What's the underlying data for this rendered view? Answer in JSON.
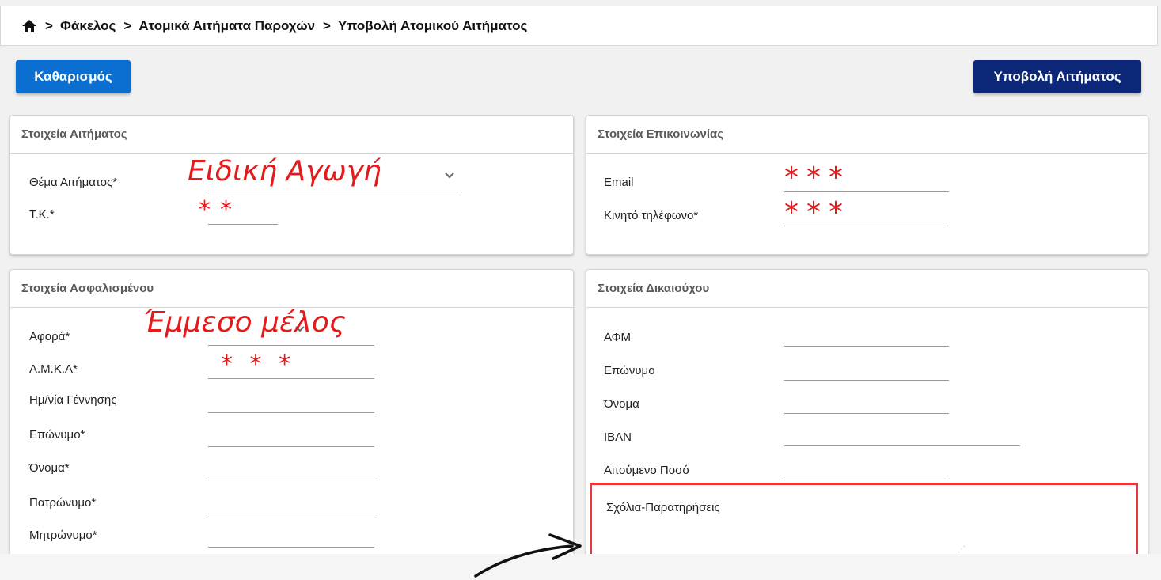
{
  "breadcrumb": {
    "home_icon": "home-icon",
    "items": [
      "Φάκελος",
      "Ατομικά Αιτήματα Παροχών",
      "Υποβολή Ατομικού Αιτήματος"
    ],
    "separator": ">"
  },
  "toolbar": {
    "clear_label": "Καθαρισμός",
    "submit_label": "Υποβολή Αιτήματος"
  },
  "request_panel": {
    "title": "Στοιχεία Αιτήματος",
    "subject_label": "Θέμα Αιτήματος*",
    "subject_value": "Ειδική Αγωγή",
    "zip_label": "Τ.Κ.*",
    "zip_value": "**"
  },
  "contact_panel": {
    "title": "Στοιχεία Επικοινωνίας",
    "email_label": "Email",
    "email_value": "***",
    "mobile_label": "Κινητό τηλέφωνο*",
    "mobile_value": "***"
  },
  "insured_panel": {
    "title": "Στοιχεία Ασφαλισμένου",
    "concerns_label": "Αφορά*",
    "concerns_value": "Έμμεσο μέλος",
    "amka_label": "Α.Μ.Κ.Α*",
    "amka_value": "* * *",
    "birthdate_label": "Ημ/νία Γέννησης",
    "surname_label": "Επώνυμο*",
    "name_label": "Όνομα*",
    "father_label": "Πατρώνυμο*",
    "mother_label": "Μητρώνυμο*"
  },
  "beneficiary_panel": {
    "title": "Στοιχεία Δικαιούχου",
    "afm_label": "ΑΦΜ",
    "surname_label": "Επώνυμο",
    "name_label": "Όνομα",
    "iban_label": "IBAN",
    "amount_label": "Αιτούμενο Ποσό",
    "comments_label": "Σχόλια-Παρατηρήσεις"
  },
  "colors": {
    "clear_button": "#0b6fd1",
    "submit_button": "#0c2777",
    "annotation": "#e61a1a"
  }
}
